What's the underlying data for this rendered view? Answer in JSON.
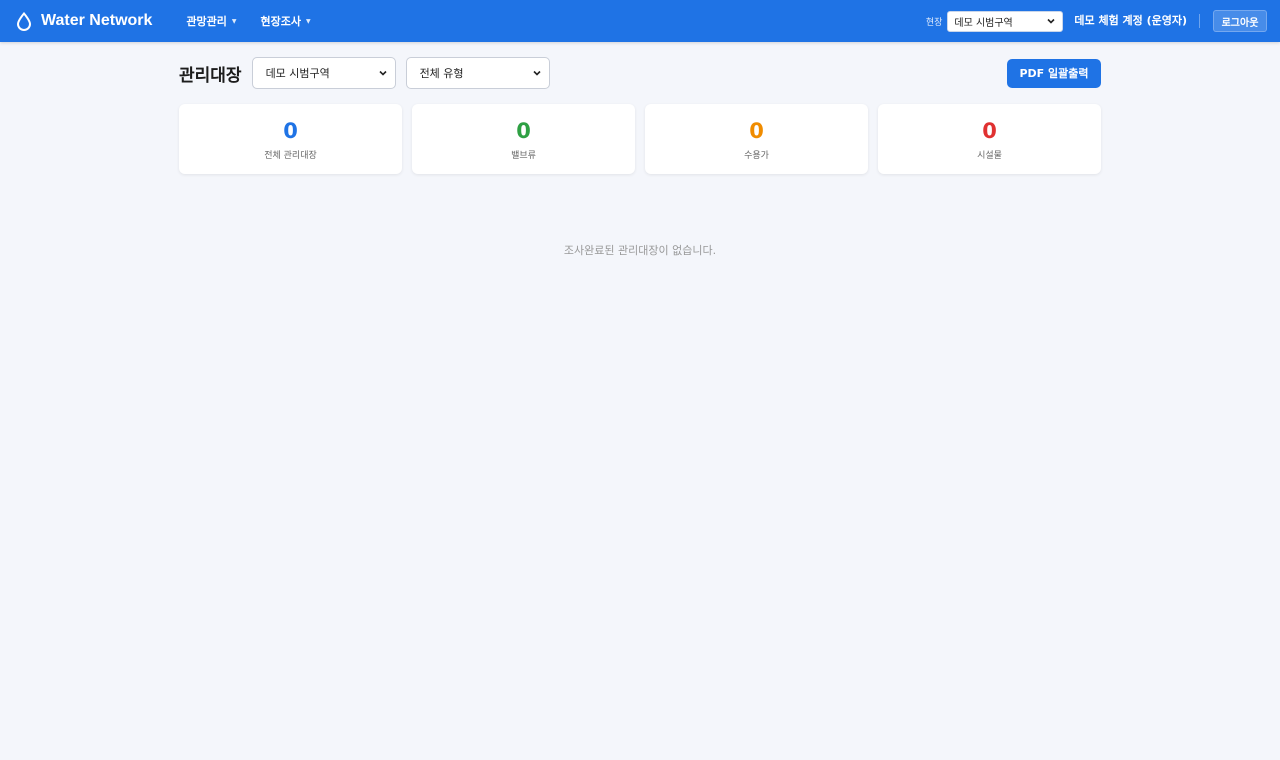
{
  "header": {
    "brand": "Water Network",
    "nav": [
      {
        "label": "관망관리"
      },
      {
        "label": "현장조사"
      }
    ],
    "site_label": "현장",
    "site_select_value": "데모 시범구역",
    "user": "데모 체험 계정 (운영자)",
    "logout": "로그아웃"
  },
  "toolbar": {
    "title": "관리대장",
    "area_select_value": "데모 시범구역",
    "type_select_value": "전체 유형",
    "pdf_button": "PDF 일괄출력"
  },
  "stats": [
    {
      "value": "0",
      "label": "전체 관리대장",
      "color": "#1f73e5"
    },
    {
      "value": "0",
      "label": "밸브류",
      "color": "#2ea043"
    },
    {
      "value": "0",
      "label": "수용가",
      "color": "#f08c00"
    },
    {
      "value": "0",
      "label": "시설물",
      "color": "#e03131"
    }
  ],
  "empty_message": "조사완료된 관리대장이 없습니다.",
  "icons": {
    "brand": "water-drop-icon",
    "select_arrow": "chevron-down-icon"
  }
}
